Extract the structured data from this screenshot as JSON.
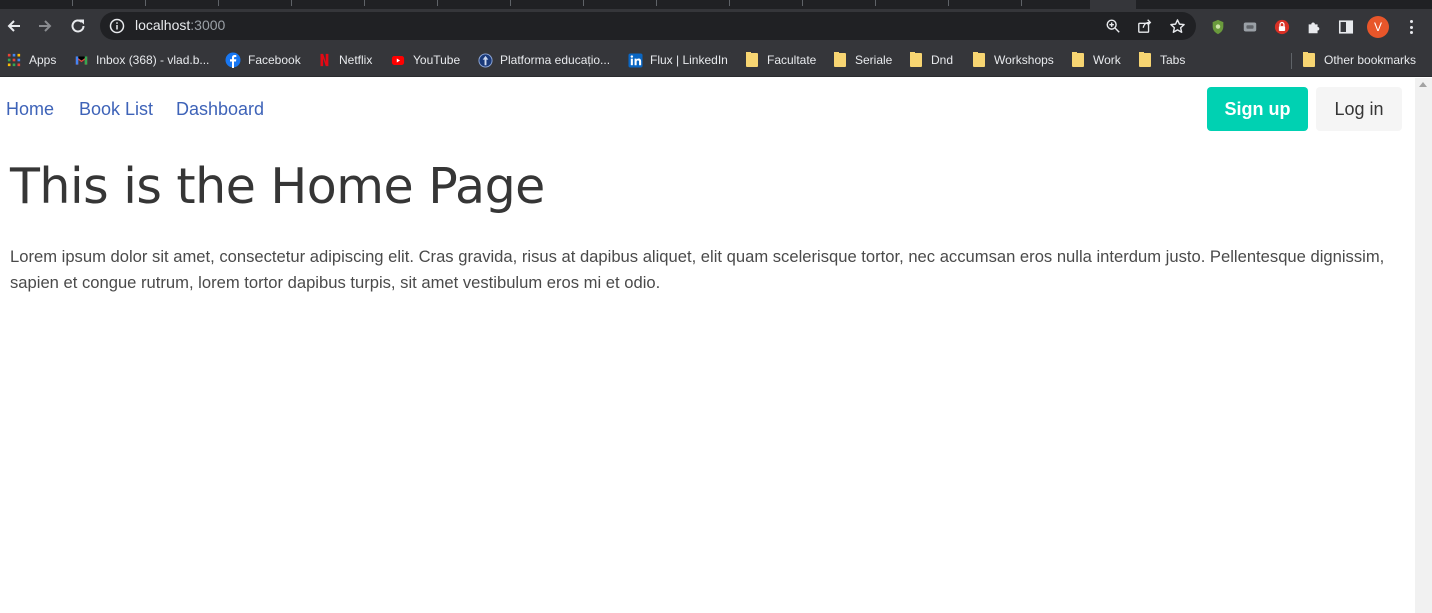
{
  "browser": {
    "url_host": "localhost",
    "url_port": ":3000",
    "avatar_letter": "V",
    "bookmarks": [
      {
        "label": "Apps",
        "icon": "apps-grid-icon"
      },
      {
        "label": "Inbox (368) - vlad.b...",
        "icon": "gmail-icon"
      },
      {
        "label": "Facebook",
        "icon": "facebook-icon"
      },
      {
        "label": "Netflix",
        "icon": "netflix-icon"
      },
      {
        "label": "YouTube",
        "icon": "youtube-icon"
      },
      {
        "label": "Platforma educațio...",
        "icon": "platform-icon"
      },
      {
        "label": "Flux | LinkedIn",
        "icon": "linkedin-icon"
      },
      {
        "label": "Facultate",
        "icon": "folder-icon"
      },
      {
        "label": "Seriale",
        "icon": "folder-icon"
      },
      {
        "label": "Dnd",
        "icon": "folder-icon"
      },
      {
        "label": "Workshops",
        "icon": "folder-icon"
      },
      {
        "label": "Work",
        "icon": "folder-icon"
      },
      {
        "label": "Tabs",
        "icon": "folder-icon"
      }
    ],
    "other_bookmarks": "Other bookmarks"
  },
  "nav": {
    "links": [
      "Home",
      "Book List",
      "Dashboard"
    ],
    "signup_label": "Sign up",
    "login_label": "Log in"
  },
  "main": {
    "title": "This is the Home Page",
    "text": "Lorem ipsum dolor sit amet, consectetur adipiscing elit. Cras gravida, risus at dapibus aliquet, elit quam scelerisque tortor, nec accumsan eros nulla interdum justo. Pellentesque dignissim, sapien et congue rutrum, lorem tortor dapibus turpis, sit amet vestibulum eros mi et odio."
  },
  "colors": {
    "chrome_dark": "#35363a",
    "link": "#3e63b8",
    "primary_button": "#00d1b2",
    "title_text": "#363636"
  }
}
